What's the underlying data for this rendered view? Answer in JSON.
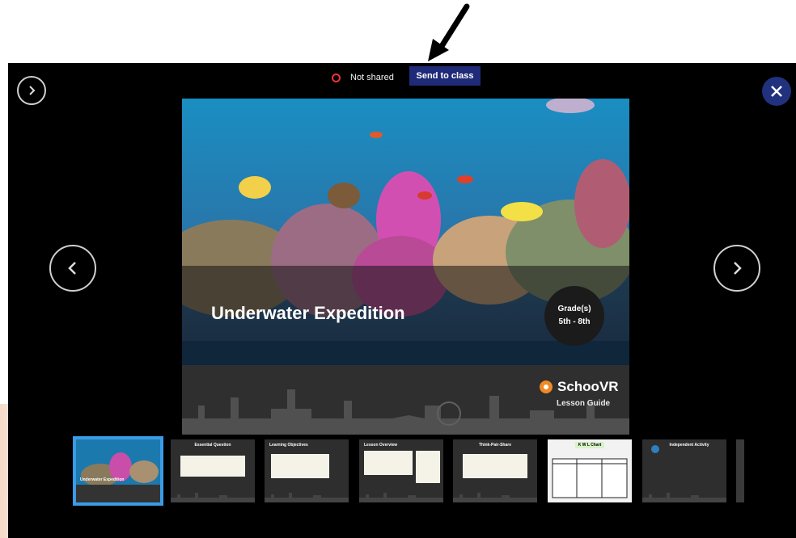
{
  "top_bar": {
    "status_label": "Not shared",
    "send_button_label": "Send to class"
  },
  "icons": {
    "top_next": "chevron-right-circle-icon",
    "close": "close-icon",
    "prev": "chevron-left-circle-icon",
    "next": "chevron-right-circle-icon"
  },
  "colors": {
    "send_button_bg": "#1f2b78",
    "close_button_bg": "#20317e",
    "status_dot": "#ee3333",
    "active_thumb_border": "#3a9be6"
  },
  "slide": {
    "title": "Underwater Expedition",
    "grade_label": "Grade(s)",
    "grade_value": "5th - 8th",
    "brand": "SchooVR",
    "brand_subtitle": "Lesson Guide"
  },
  "thumbnails": [
    {
      "title": "Underwater Expedition",
      "active": true
    },
    {
      "title": "Essential Question",
      "active": false
    },
    {
      "title": "Learning Objectives",
      "active": false
    },
    {
      "title": "Lesson Overview",
      "active": false
    },
    {
      "title": "Think-Pair-Share",
      "active": false
    },
    {
      "title": "K W L Chart",
      "active": false
    },
    {
      "title": "Independent Activity",
      "active": false
    }
  ]
}
